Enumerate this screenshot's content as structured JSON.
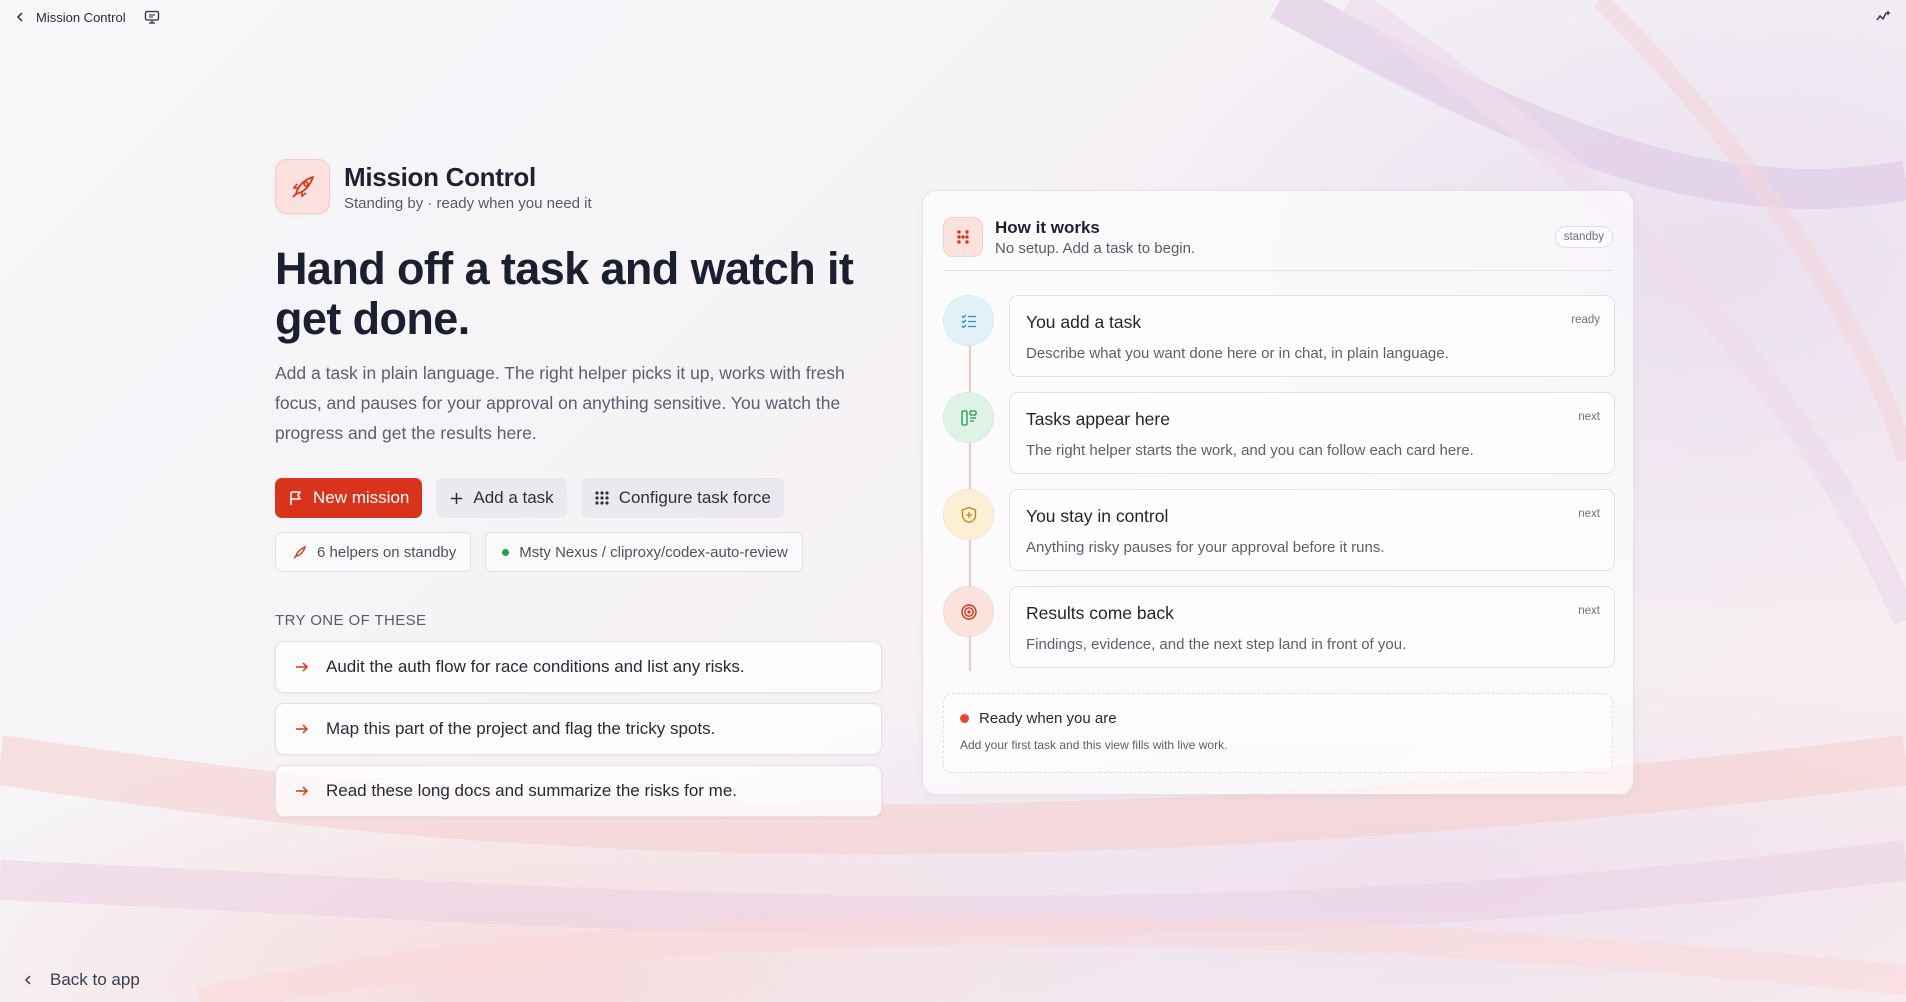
{
  "topbar": {
    "back_label": "Mission Control"
  },
  "brand": {
    "title": "Mission Control",
    "subtitle": "Standing by · ready when you need it"
  },
  "hero": {
    "headline": "Hand off a task and watch it get done.",
    "lead": "Add a task in plain language. The right helper picks it up, works with fresh focus, and pauses for your approval on anything sensitive. You watch the progress and get the results here."
  },
  "actions": {
    "new_mission": "New mission",
    "add_task": "Add a task",
    "configure": "Configure task force"
  },
  "chips": {
    "helpers": "6 helpers on standby",
    "model": "Msty Nexus / cliproxy/codex-auto-review"
  },
  "suggestions": {
    "title": "TRY ONE OF THESE",
    "items": [
      "Audit the auth flow for race conditions and list any risks.",
      "Map this part of the project and flag the tricky spots.",
      "Read these long docs and summarize the risks for me."
    ]
  },
  "panel": {
    "title": "How it works",
    "subtitle": "No setup. Add a task to begin.",
    "badge": "standby",
    "steps": [
      {
        "title": "You add a task",
        "desc": "Describe what you want done here or in chat, in plain language.",
        "state": "ready",
        "icon": "list-check-icon",
        "color": "#2a8fbf"
      },
      {
        "title": "Tasks appear here",
        "desc": "The right helper starts the work, and you can follow each card here.",
        "state": "next",
        "icon": "board-icon",
        "color": "#1e9a55"
      },
      {
        "title": "You stay in control",
        "desc": "Anything risky pauses for your approval before it runs.",
        "state": "next",
        "icon": "shield-icon",
        "color": "#c08a12"
      },
      {
        "title": "Results come back",
        "desc": "Findings, evidence, and the next step land in front of you.",
        "state": "next",
        "icon": "target-icon",
        "color": "#d9341b"
      }
    ],
    "ready_title": "Ready when you are",
    "ready_sub": "Add your first task and this view fills with live work."
  },
  "footer": {
    "back_label": "Back to app"
  },
  "colors": {
    "accent": "#d9341b",
    "status_green": "#1aa34a",
    "status_red": "#e5452c"
  }
}
